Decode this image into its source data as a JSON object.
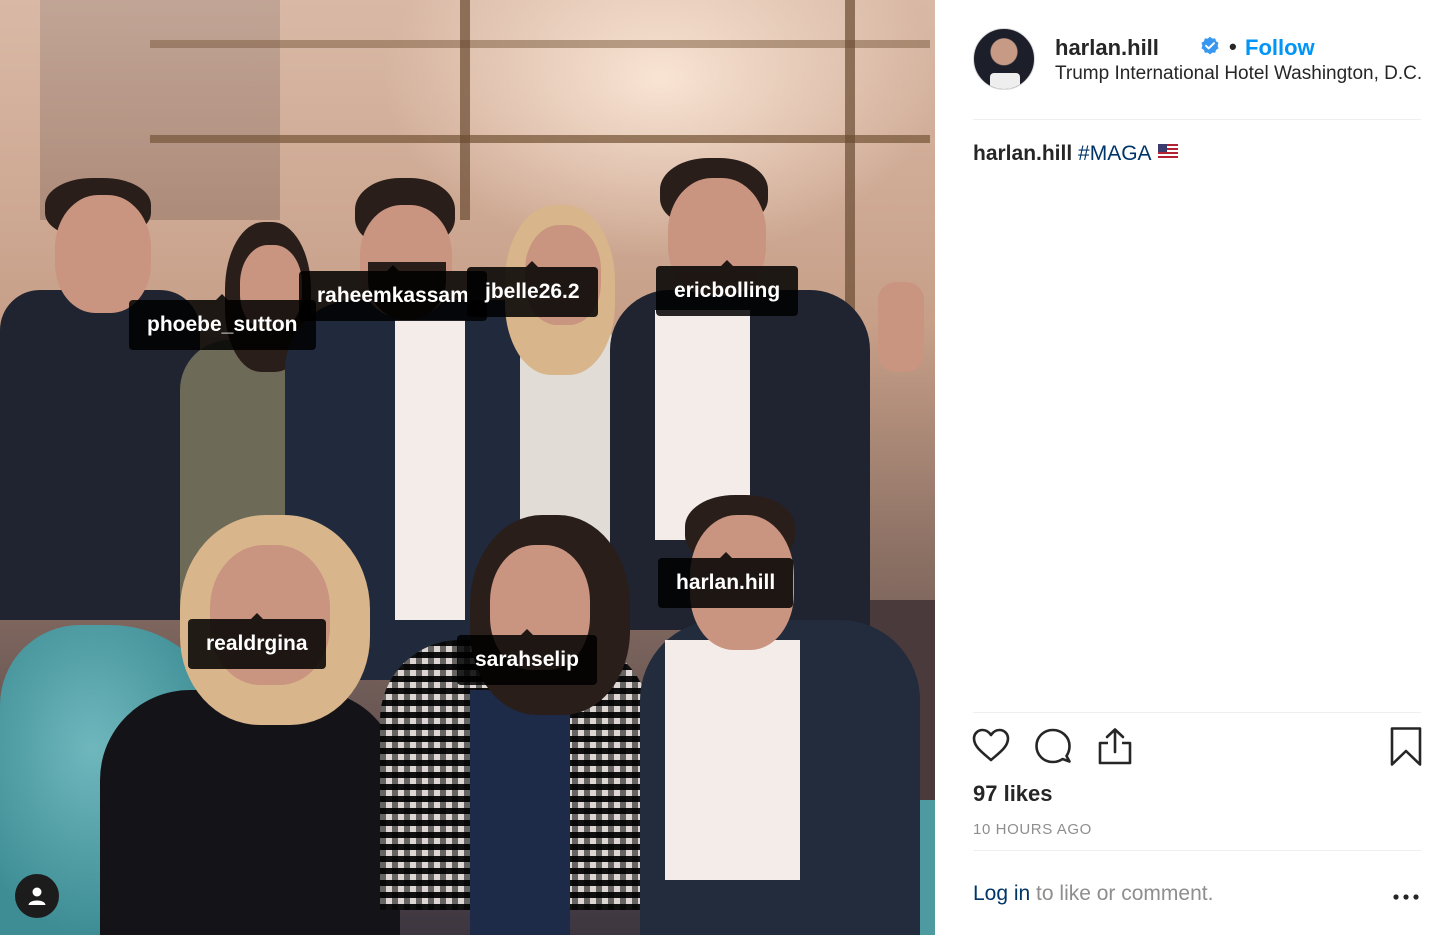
{
  "post": {
    "photo_tags": [
      "phoebe_sutton",
      "raheemkassam",
      "jbelle26.2",
      "ericbolling",
      "harlan.hill",
      "realdrgina",
      "sarahselip"
    ],
    "tags_button_icon": "user-icon"
  },
  "header": {
    "username": "harlan.hill",
    "verified_icon": "verified-badge-icon",
    "separator": "•",
    "follow_label": "Follow",
    "location": "Trump International Hotel Washington, D.C."
  },
  "caption": {
    "username": "harlan.hill",
    "hashtag": "#MAGA",
    "emoji": "us-flag"
  },
  "actions": {
    "like_icon": "heart-icon",
    "comment_icon": "comment-icon",
    "share_icon": "share-icon",
    "save_icon": "bookmark-icon"
  },
  "likes_text": "97 likes",
  "timestamp": "10 HOURS AGO",
  "footer": {
    "login_label": "Log in",
    "login_suffix": " to like or comment.",
    "more_icon": "more-options-icon"
  },
  "colors": {
    "link_blue": "#0095f6",
    "hashtag_navy": "#003569",
    "muted_gray": "#8e8e8e",
    "tag_background": "#000000"
  }
}
